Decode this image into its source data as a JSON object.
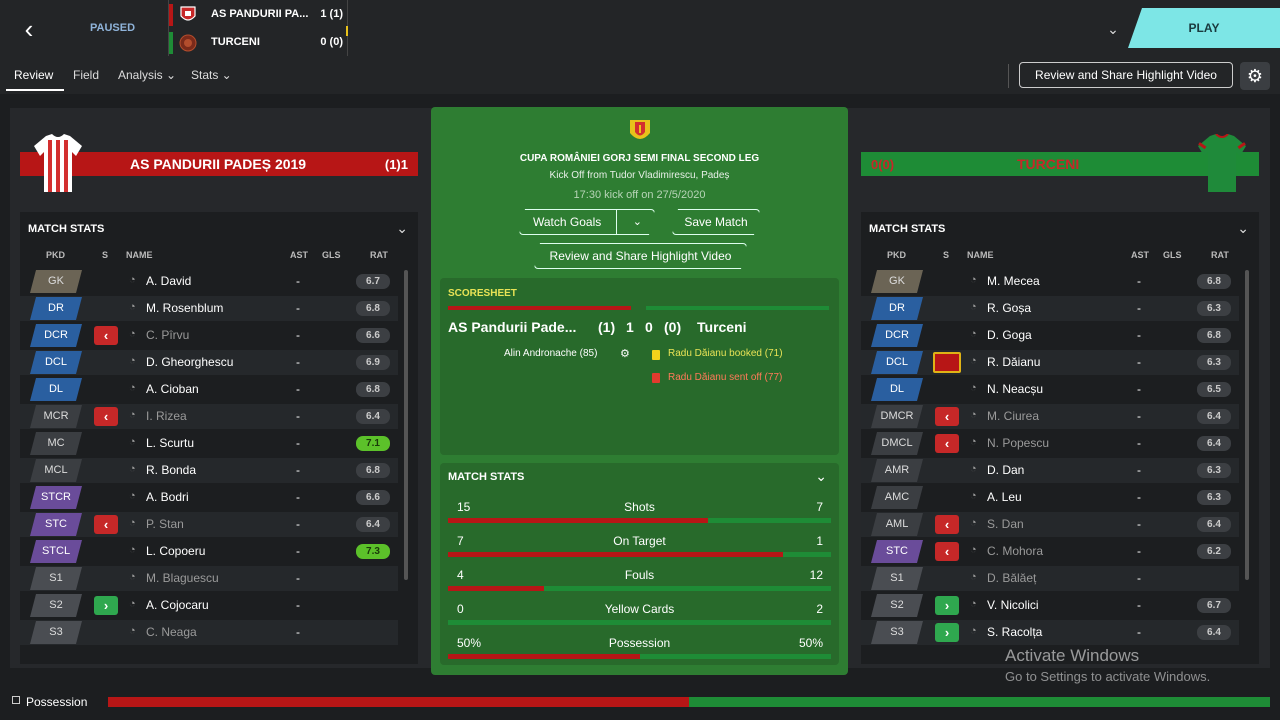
{
  "top": {
    "status": "PAUSED",
    "play_label": "PLAY",
    "home": {
      "name": "AS PANDURII PA...",
      "score": "1 (1)"
    },
    "away": {
      "name": "TURCENI",
      "score": "0 (0)"
    },
    "highlight_btn": "Review and Share Highlight Video"
  },
  "tabs": [
    "Review",
    "Field",
    "Analysis ⌄",
    "Stats ⌄"
  ],
  "colors": {
    "home": "#b71616",
    "away": "#1e8c36",
    "accent": "#7de6e6"
  },
  "home_banner": {
    "name": "AS PANDURII PADEȘ 2019",
    "score": "(1)1"
  },
  "away_banner": {
    "name": "TURCENI",
    "score": "0(0)"
  },
  "panel": {
    "title": "MATCH STATS",
    "cols": {
      "pkd": "PKD",
      "s": "S",
      "name": "NAME",
      "ast": "AST",
      "gls": "GLS",
      "rat": "RAT"
    }
  },
  "home_players": [
    {
      "pos": "GK",
      "sub": "",
      "name": "A. David",
      "ast": "-",
      "rat": "6.7",
      "dim": false,
      "good": false
    },
    {
      "pos": "DR",
      "sub": "",
      "name": "M. Rosenblum",
      "ast": "-",
      "rat": "6.8",
      "dim": false,
      "good": false
    },
    {
      "pos": "DCR",
      "sub": "off",
      "name": "C. Pîrvu",
      "ast": "-",
      "rat": "6.6",
      "dim": true,
      "good": false
    },
    {
      "pos": "DCL",
      "sub": "",
      "name": "D. Gheorghescu",
      "ast": "-",
      "rat": "6.9",
      "dim": false,
      "good": false
    },
    {
      "pos": "DL",
      "sub": "",
      "name": "A. Cioban",
      "ast": "-",
      "rat": "6.8",
      "dim": false,
      "good": false
    },
    {
      "pos": "MCR",
      "sub": "off",
      "name": "I. Rizea",
      "ast": "-",
      "rat": "6.4",
      "dim": true,
      "good": false
    },
    {
      "pos": "MC",
      "sub": "",
      "name": "L. Scurtu",
      "ast": "-",
      "rat": "7.1",
      "dim": false,
      "good": true
    },
    {
      "pos": "MCL",
      "sub": "",
      "name": "R. Bonda",
      "ast": "-",
      "rat": "6.8",
      "dim": false,
      "good": false
    },
    {
      "pos": "STCR",
      "sub": "",
      "name": "A. Bodri",
      "ast": "-",
      "rat": "6.6",
      "dim": false,
      "good": false
    },
    {
      "pos": "STC",
      "sub": "off",
      "name": "P. Stan",
      "ast": "-",
      "rat": "6.4",
      "dim": true,
      "good": false
    },
    {
      "pos": "STCL",
      "sub": "",
      "name": "L. Copoeru",
      "ast": "-",
      "rat": "7.3",
      "dim": false,
      "good": true
    },
    {
      "pos": "S1",
      "sub": "",
      "name": "M. Blaguescu",
      "ast": "-",
      "rat": "",
      "dim": true,
      "good": false
    },
    {
      "pos": "S2",
      "sub": "on",
      "name": "A. Cojocaru",
      "ast": "-",
      "rat": "",
      "dim": false,
      "good": false
    },
    {
      "pos": "S3",
      "sub": "",
      "name": "C. Neaga",
      "ast": "-",
      "rat": "",
      "dim": true,
      "good": false
    }
  ],
  "away_players": [
    {
      "pos": "GK",
      "sub": "",
      "name": "M. Mecea",
      "ast": "-",
      "rat": "6.8",
      "dim": false,
      "good": false
    },
    {
      "pos": "DR",
      "sub": "",
      "name": "R. Goșa",
      "ast": "-",
      "rat": "6.3",
      "dim": false,
      "good": false
    },
    {
      "pos": "DCR",
      "sub": "",
      "name": "D. Goga",
      "ast": "-",
      "rat": "6.8",
      "dim": false,
      "good": false
    },
    {
      "pos": "DCL",
      "sub": "card",
      "name": "R. Dăianu",
      "ast": "-",
      "rat": "6.3",
      "dim": false,
      "good": false
    },
    {
      "pos": "DL",
      "sub": "",
      "name": "N. Neacșu",
      "ast": "-",
      "rat": "6.5",
      "dim": false,
      "good": false
    },
    {
      "pos": "DMCR",
      "sub": "off",
      "name": "M. Ciurea",
      "ast": "-",
      "rat": "6.4",
      "dim": true,
      "good": false
    },
    {
      "pos": "DMCL",
      "sub": "off",
      "name": "N. Popescu",
      "ast": "-",
      "rat": "6.4",
      "dim": true,
      "good": false
    },
    {
      "pos": "AMR",
      "sub": "",
      "name": "D. Dan",
      "ast": "-",
      "rat": "6.3",
      "dim": false,
      "good": false
    },
    {
      "pos": "AMC",
      "sub": "",
      "name": "A. Leu",
      "ast": "-",
      "rat": "6.3",
      "dim": false,
      "good": false
    },
    {
      "pos": "AML",
      "sub": "off",
      "name": "S. Dan",
      "ast": "-",
      "rat": "6.4",
      "dim": true,
      "good": false
    },
    {
      "pos": "STC",
      "sub": "off",
      "name": "C. Mohora",
      "ast": "-",
      "rat": "6.2",
      "dim": true,
      "good": false
    },
    {
      "pos": "S1",
      "sub": "",
      "name": "D. Bălăeț",
      "ast": "-",
      "rat": "",
      "dim": true,
      "good": false
    },
    {
      "pos": "S2",
      "sub": "on",
      "name": "V. Nicolici",
      "ast": "-",
      "rat": "6.7",
      "dim": false,
      "good": false
    },
    {
      "pos": "S3",
      "sub": "on",
      "name": "S. Racolța",
      "ast": "-",
      "rat": "6.4",
      "dim": false,
      "good": false
    }
  ],
  "center": {
    "cup_title": "CUPA ROMÂNIEI GORJ SEMI FINAL SECOND LEG",
    "kickoff": "Kick Off from Tudor Vladimirescu, Padeș",
    "kickoff_time": "17:30 kick off on 27/5/2020",
    "watch_goals": "Watch Goals",
    "save_match": "Save Match",
    "highlight_btn": "Review and Share Highlight Video",
    "scoresheet": {
      "title": "SCORESHEET",
      "home": "AS Pandurii Pade...",
      "home_ht": "(1)",
      "home_goals": "1",
      "away_goals": "0",
      "away_ht": "(0)",
      "away": "Turceni",
      "goal_event": "Alin Andronache (85)",
      "booking_event": "Radu Dăianu booked (71)",
      "sentoff_event": "Radu Dăianu sent off (77)"
    },
    "match_stats_title": "MATCH STATS",
    "stats": [
      {
        "label": "Shots",
        "home": "15",
        "away": "7",
        "home_share": 0.68
      },
      {
        "label": "On Target",
        "home": "7",
        "away": "1",
        "home_share": 0.875
      },
      {
        "label": "Fouls",
        "home": "4",
        "away": "12",
        "home_share": 0.25
      },
      {
        "label": "Yellow Cards",
        "home": "0",
        "away": "2",
        "home_share": 0.0
      },
      {
        "label": "Possession",
        "home": "50%",
        "away": "50%",
        "home_share": 0.5
      }
    ]
  },
  "bottom": {
    "label": "Possession",
    "home_share": 0.5
  },
  "watermark": {
    "line1": "Activate Windows",
    "line2": "Go to Settings to activate Windows."
  }
}
